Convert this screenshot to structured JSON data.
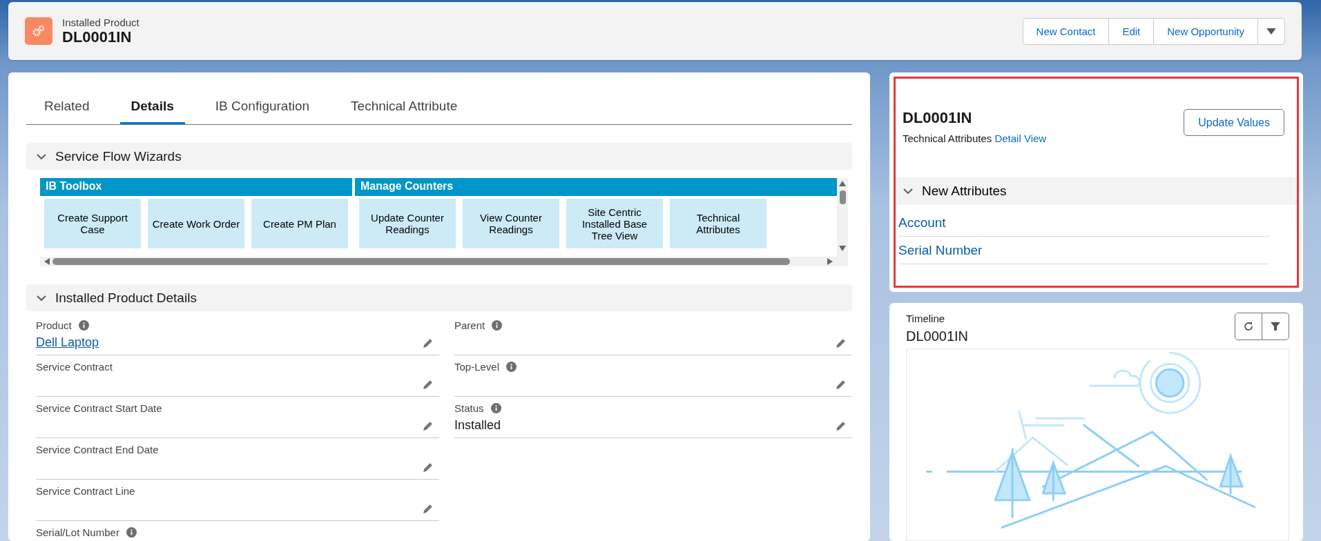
{
  "header": {
    "object_type": "Installed Product",
    "title": "DL0001IN",
    "actions": [
      "New Contact",
      "Edit",
      "New Opportunity"
    ]
  },
  "tabs": [
    {
      "label": "Related",
      "selected": false
    },
    {
      "label": "Details",
      "selected": true
    },
    {
      "label": "IB Configuration",
      "selected": false
    },
    {
      "label": "Technical Attribute",
      "selected": false
    }
  ],
  "wizards": {
    "title": "Service Flow Wizards",
    "expanded": true,
    "groups": [
      {
        "title": "IB Toolbox",
        "buttons": [
          "Create Support Case",
          "Create Work Order",
          "Create PM Plan"
        ]
      },
      {
        "title": "Manage Counters",
        "buttons": [
          "Update Counter Readings",
          "View Counter Readings",
          "Site Centric Installed Base Tree View",
          "Technical Attributes"
        ]
      }
    ]
  },
  "details": {
    "title": "Installed Product Details",
    "expanded": true,
    "left": [
      {
        "label": "Product",
        "info": true,
        "value": "Dell Laptop",
        "kind": "link"
      },
      {
        "label": "Service Contract",
        "info": false
      },
      {
        "label": "Service Contract Start Date",
        "info": false
      },
      {
        "label": "Service Contract End Date",
        "info": false
      },
      {
        "label": "Service Contract Line",
        "info": false
      },
      {
        "label": "Serial/Lot Number",
        "info": true
      }
    ],
    "right": [
      {
        "label": "Parent",
        "info": true
      },
      {
        "label": "Top-Level",
        "info": true
      },
      {
        "label": "Status",
        "info": true,
        "value": "Installed",
        "kind": "text"
      }
    ]
  },
  "attributes": {
    "title": "DL0001IN",
    "subtitle": "Technical Attributes",
    "link": "Detail View",
    "button": "Update Values",
    "section": {
      "title": "New Attributes",
      "expanded": true,
      "items": [
        "Account",
        "Serial Number"
      ]
    }
  },
  "timeline": {
    "label": "Timeline",
    "title": "DL0001IN"
  }
}
